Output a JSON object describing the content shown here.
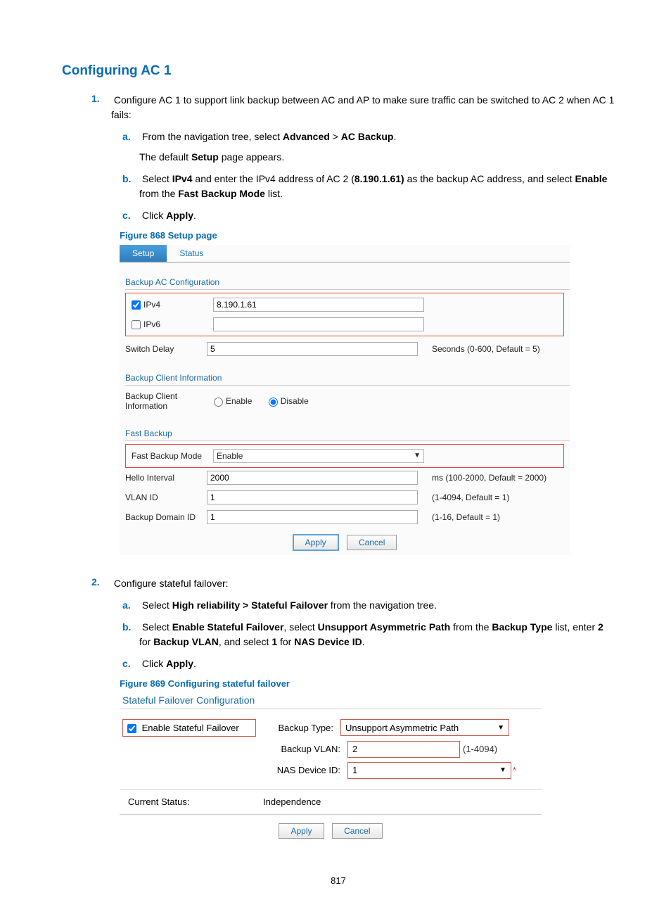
{
  "heading": "Configuring AC 1",
  "step1": {
    "num": "1.",
    "intro_a": "Configure AC 1 to support link backup between AC and AP to make sure traffic can be switched to AC 2 when AC 1 fails:",
    "a": {
      "m": "a.",
      "pre": "From the navigation tree, select ",
      "b1": "Advanced",
      "sep": " > ",
      "b2": "AC Backup",
      "post": "."
    },
    "a_after_pre": "The default ",
    "a_after_b": "Setup",
    "a_after_post": " page appears.",
    "b": {
      "m": "b.",
      "pre": "Select ",
      "b1": "IPv4",
      "mid1": " and enter the IPv4 address of AC 2 (",
      "b2": "8.190.1.61)",
      "mid2": " as the backup AC address, and select ",
      "b3": "Enable",
      "mid3": " from the ",
      "b4": "Fast Backup Mode",
      "post": " list."
    },
    "c": {
      "m": "c.",
      "pre": "Click ",
      "b1": "Apply",
      "post": "."
    }
  },
  "fig868": {
    "caption": "Figure 868 Setup page",
    "tabs": {
      "active": "Setup",
      "other": "Status"
    },
    "section1": "Backup AC Configuration",
    "ipv4_label": "IPv4",
    "ipv4_value": "8.190.1.61",
    "ipv6_label": "IPv6",
    "ipv6_value": "",
    "switch_delay_label": "Switch Delay",
    "switch_delay_value": "5",
    "switch_delay_hint": "Seconds (0-600, Default = 5)",
    "section2": "Backup Client Information",
    "bci_label": "Backup Client Information",
    "bci_enable": "Enable",
    "bci_disable": "Disable",
    "section3": "Fast Backup",
    "fbm_label": "Fast Backup Mode",
    "fbm_value": "Enable",
    "hello_label": "Hello Interval",
    "hello_value": "2000",
    "hello_hint": "ms (100-2000, Default = 2000)",
    "vlan_label": "VLAN ID",
    "vlan_value": "1",
    "vlan_hint": "(1-4094, Default = 1)",
    "bdid_label": "Backup Domain ID",
    "bdid_value": "1",
    "bdid_hint": "(1-16, Default = 1)",
    "apply": "Apply",
    "cancel": "Cancel"
  },
  "step2": {
    "num": "2.",
    "intro": "Configure stateful failover:",
    "a": {
      "m": "a.",
      "pre": "Select ",
      "b1": "High reliability > Stateful Failover",
      "post": " from the navigation tree."
    },
    "b": {
      "m": "b.",
      "pre": "Select ",
      "b1": "Enable Stateful Failover",
      "mid1": ", select ",
      "b2": "Unsupport Asymmetric Path",
      "mid2": " from the ",
      "b3": "Backup Type",
      "mid3": " list, enter ",
      "b4": "2",
      "mid4": " for ",
      "b5": "Backup VLAN",
      "mid5": ", and select ",
      "b6": "1",
      "mid6": " for ",
      "b7": "NAS Device ID",
      "post": "."
    },
    "c": {
      "m": "c.",
      "pre": "Click ",
      "b1": "Apply",
      "post": "."
    }
  },
  "fig869": {
    "caption": "Figure 869 Configuring stateful failover",
    "title": "Stateful Failover Configuration",
    "esf_label": "Enable Stateful Failover",
    "bt_label": "Backup Type:",
    "bt_value": "Unsupport Asymmetric Path",
    "bvlan_label": "Backup VLAN:",
    "bvlan_value": "2",
    "bvlan_hint": "(1-4094)",
    "nas_label": "NAS Device ID:",
    "nas_value": "1",
    "star": "*",
    "cs_label": "Current Status:",
    "cs_value": "Independence",
    "apply": "Apply",
    "cancel": "Cancel"
  },
  "page_number": "817"
}
